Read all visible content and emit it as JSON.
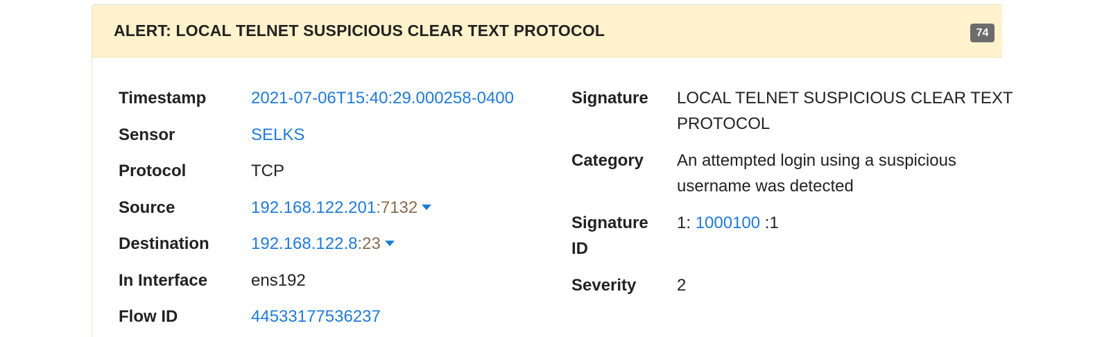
{
  "alert": {
    "title": "ALERT: LOCAL TELNET SUSPICIOUS CLEAR TEXT PROTOCOL",
    "badge": "74"
  },
  "left_fields": {
    "timestamp": {
      "label": "Timestamp",
      "value": "2021-07-06T15:40:29.000258-0400"
    },
    "sensor": {
      "label": "Sensor",
      "value": "SELKS"
    },
    "protocol": {
      "label": "Protocol",
      "value": "TCP"
    },
    "source": {
      "label": "Source",
      "ip": "192.168.122.201",
      "sep": ":",
      "port": "7132"
    },
    "destination": {
      "label": "Destination",
      "ip": "192.168.122.8",
      "sep": ":",
      "port": "23"
    },
    "in_interface": {
      "label": "In Interface",
      "value": "ens192"
    },
    "flow_id": {
      "label": "Flow ID",
      "value": "44533177536237"
    }
  },
  "right_fields": {
    "signature": {
      "label": "Signature",
      "line1": "LOCAL TELNET SUSPICIOUS CLEAR TEXT",
      "line2": "PROTOCOL"
    },
    "category": {
      "label": "Category",
      "line1": "An attempted login using a suspicious",
      "line2": "username was detected"
    },
    "signature_id": {
      "label_line1": "Signature",
      "label_line2": "ID",
      "gid": "1:",
      "sid": "1000100",
      "rev": ":1"
    },
    "severity": {
      "label": "Severity",
      "value": "2"
    }
  },
  "colors": {
    "header_bg": "#fff2cc",
    "link": "#1f7ad8",
    "port": "#8a6a4f",
    "badge_bg": "#6c6c6c"
  }
}
